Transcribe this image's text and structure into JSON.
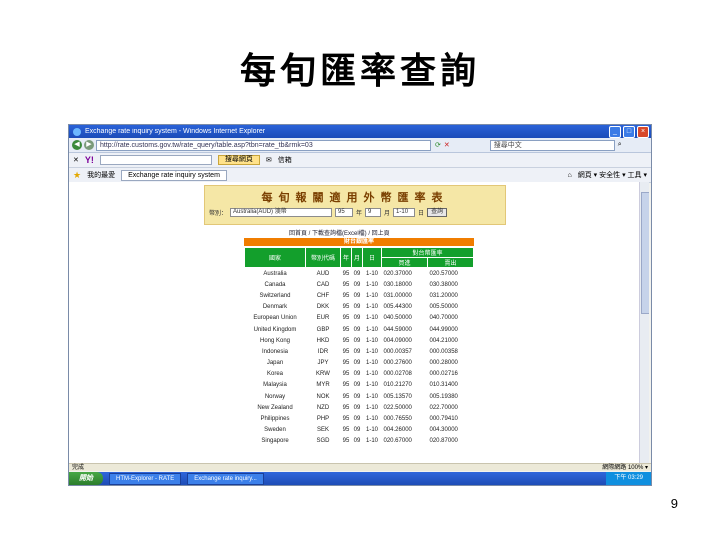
{
  "slide": {
    "title": "每旬匯率查詢",
    "page_number": "9"
  },
  "browser": {
    "window_title": "Exchange rate inquiry system - Windows Internet Explorer",
    "address": "http://rate.customs.gov.tw/rate_query/table.asp?tbn=rate_tb&rmk=03",
    "search_placeholder": "搜尋中文",
    "yahoo_brand": "Y!",
    "yahoo_search_button": "搜尋網頁",
    "yahoo_mail": "信箱",
    "favorites_label": "我的最愛",
    "tab_label": "Exchange rate inquiry system",
    "menu_right": "網頁 ▾   安全性 ▾   工具 ▾",
    "status_left": "完成",
    "status_right": "網際網路   100% ▾",
    "start_label": "開始",
    "taskbar_items": [
      "HTM-Explorer - RATE",
      "Exchange rate inquiry..."
    ],
    "tray_time": "下午 03:29"
  },
  "page": {
    "banner_title": "每旬報關適用外幣匯率表",
    "filter_label": "幣別：",
    "currency_selected": "Australia(AUD) 澳幣",
    "year_value": "95",
    "year_label": "年",
    "month_value": "9",
    "month_label": "月",
    "day_value": "1-10",
    "day_label": "日",
    "query_button": "查詢",
    "crumb": "回首頁 / 下載查詢檔(Excel檔) / 回上頁",
    "bank_header": "財台銀匯率",
    "columns": {
      "country": "國家",
      "code": "幣別代碼",
      "year": "年",
      "month": "月",
      "day": "日",
      "rate_group": "對台幣匯率",
      "buy": "買進",
      "sell": "賣出"
    },
    "rows": [
      {
        "country": "Australia",
        "code": "AUD",
        "y": "95",
        "m": "09",
        "d": "1-10",
        "buy": "020.37000",
        "sell": "020.57000"
      },
      {
        "country": "Canada",
        "code": "CAD",
        "y": "95",
        "m": "09",
        "d": "1-10",
        "buy": "030.18000",
        "sell": "030.38000"
      },
      {
        "country": "Switzerland",
        "code": "CHF",
        "y": "95",
        "m": "09",
        "d": "1-10",
        "buy": "031.00000",
        "sell": "031.20000"
      },
      {
        "country": "Denmark",
        "code": "DKK",
        "y": "95",
        "m": "09",
        "d": "1-10",
        "buy": "005.44300",
        "sell": "005.50000"
      },
      {
        "country": "European Union",
        "code": "EUR",
        "y": "95",
        "m": "09",
        "d": "1-10",
        "buy": "040.50000",
        "sell": "040.70000"
      },
      {
        "country": "United Kingdom",
        "code": "GBP",
        "y": "95",
        "m": "09",
        "d": "1-10",
        "buy": "044.59000",
        "sell": "044.99000"
      },
      {
        "country": "Hong Kong",
        "code": "HKD",
        "y": "95",
        "m": "09",
        "d": "1-10",
        "buy": "004.09000",
        "sell": "004.21000"
      },
      {
        "country": "Indonesia",
        "code": "IDR",
        "y": "95",
        "m": "09",
        "d": "1-10",
        "buy": "000.00357",
        "sell": "000.00358"
      },
      {
        "country": "Japan",
        "code": "JPY",
        "y": "95",
        "m": "09",
        "d": "1-10",
        "buy": "000.27600",
        "sell": "000.28000"
      },
      {
        "country": "Korea",
        "code": "KRW",
        "y": "95",
        "m": "09",
        "d": "1-10",
        "buy": "000.02708",
        "sell": "000.02716"
      },
      {
        "country": "Malaysia",
        "code": "MYR",
        "y": "95",
        "m": "09",
        "d": "1-10",
        "buy": "010.21270",
        "sell": "010.31400"
      },
      {
        "country": "Norway",
        "code": "NOK",
        "y": "95",
        "m": "09",
        "d": "1-10",
        "buy": "005.13570",
        "sell": "005.19380"
      },
      {
        "country": "New Zealand",
        "code": "NZD",
        "y": "95",
        "m": "09",
        "d": "1-10",
        "buy": "022.50000",
        "sell": "022.70000"
      },
      {
        "country": "Philippines",
        "code": "PHP",
        "y": "95",
        "m": "09",
        "d": "1-10",
        "buy": "000.76550",
        "sell": "000.79410"
      },
      {
        "country": "Sweden",
        "code": "SEK",
        "y": "95",
        "m": "09",
        "d": "1-10",
        "buy": "004.26000",
        "sell": "004.30000"
      },
      {
        "country": "Singapore",
        "code": "SGD",
        "y": "95",
        "m": "09",
        "d": "1-10",
        "buy": "020.67000",
        "sell": "020.87000"
      }
    ]
  }
}
